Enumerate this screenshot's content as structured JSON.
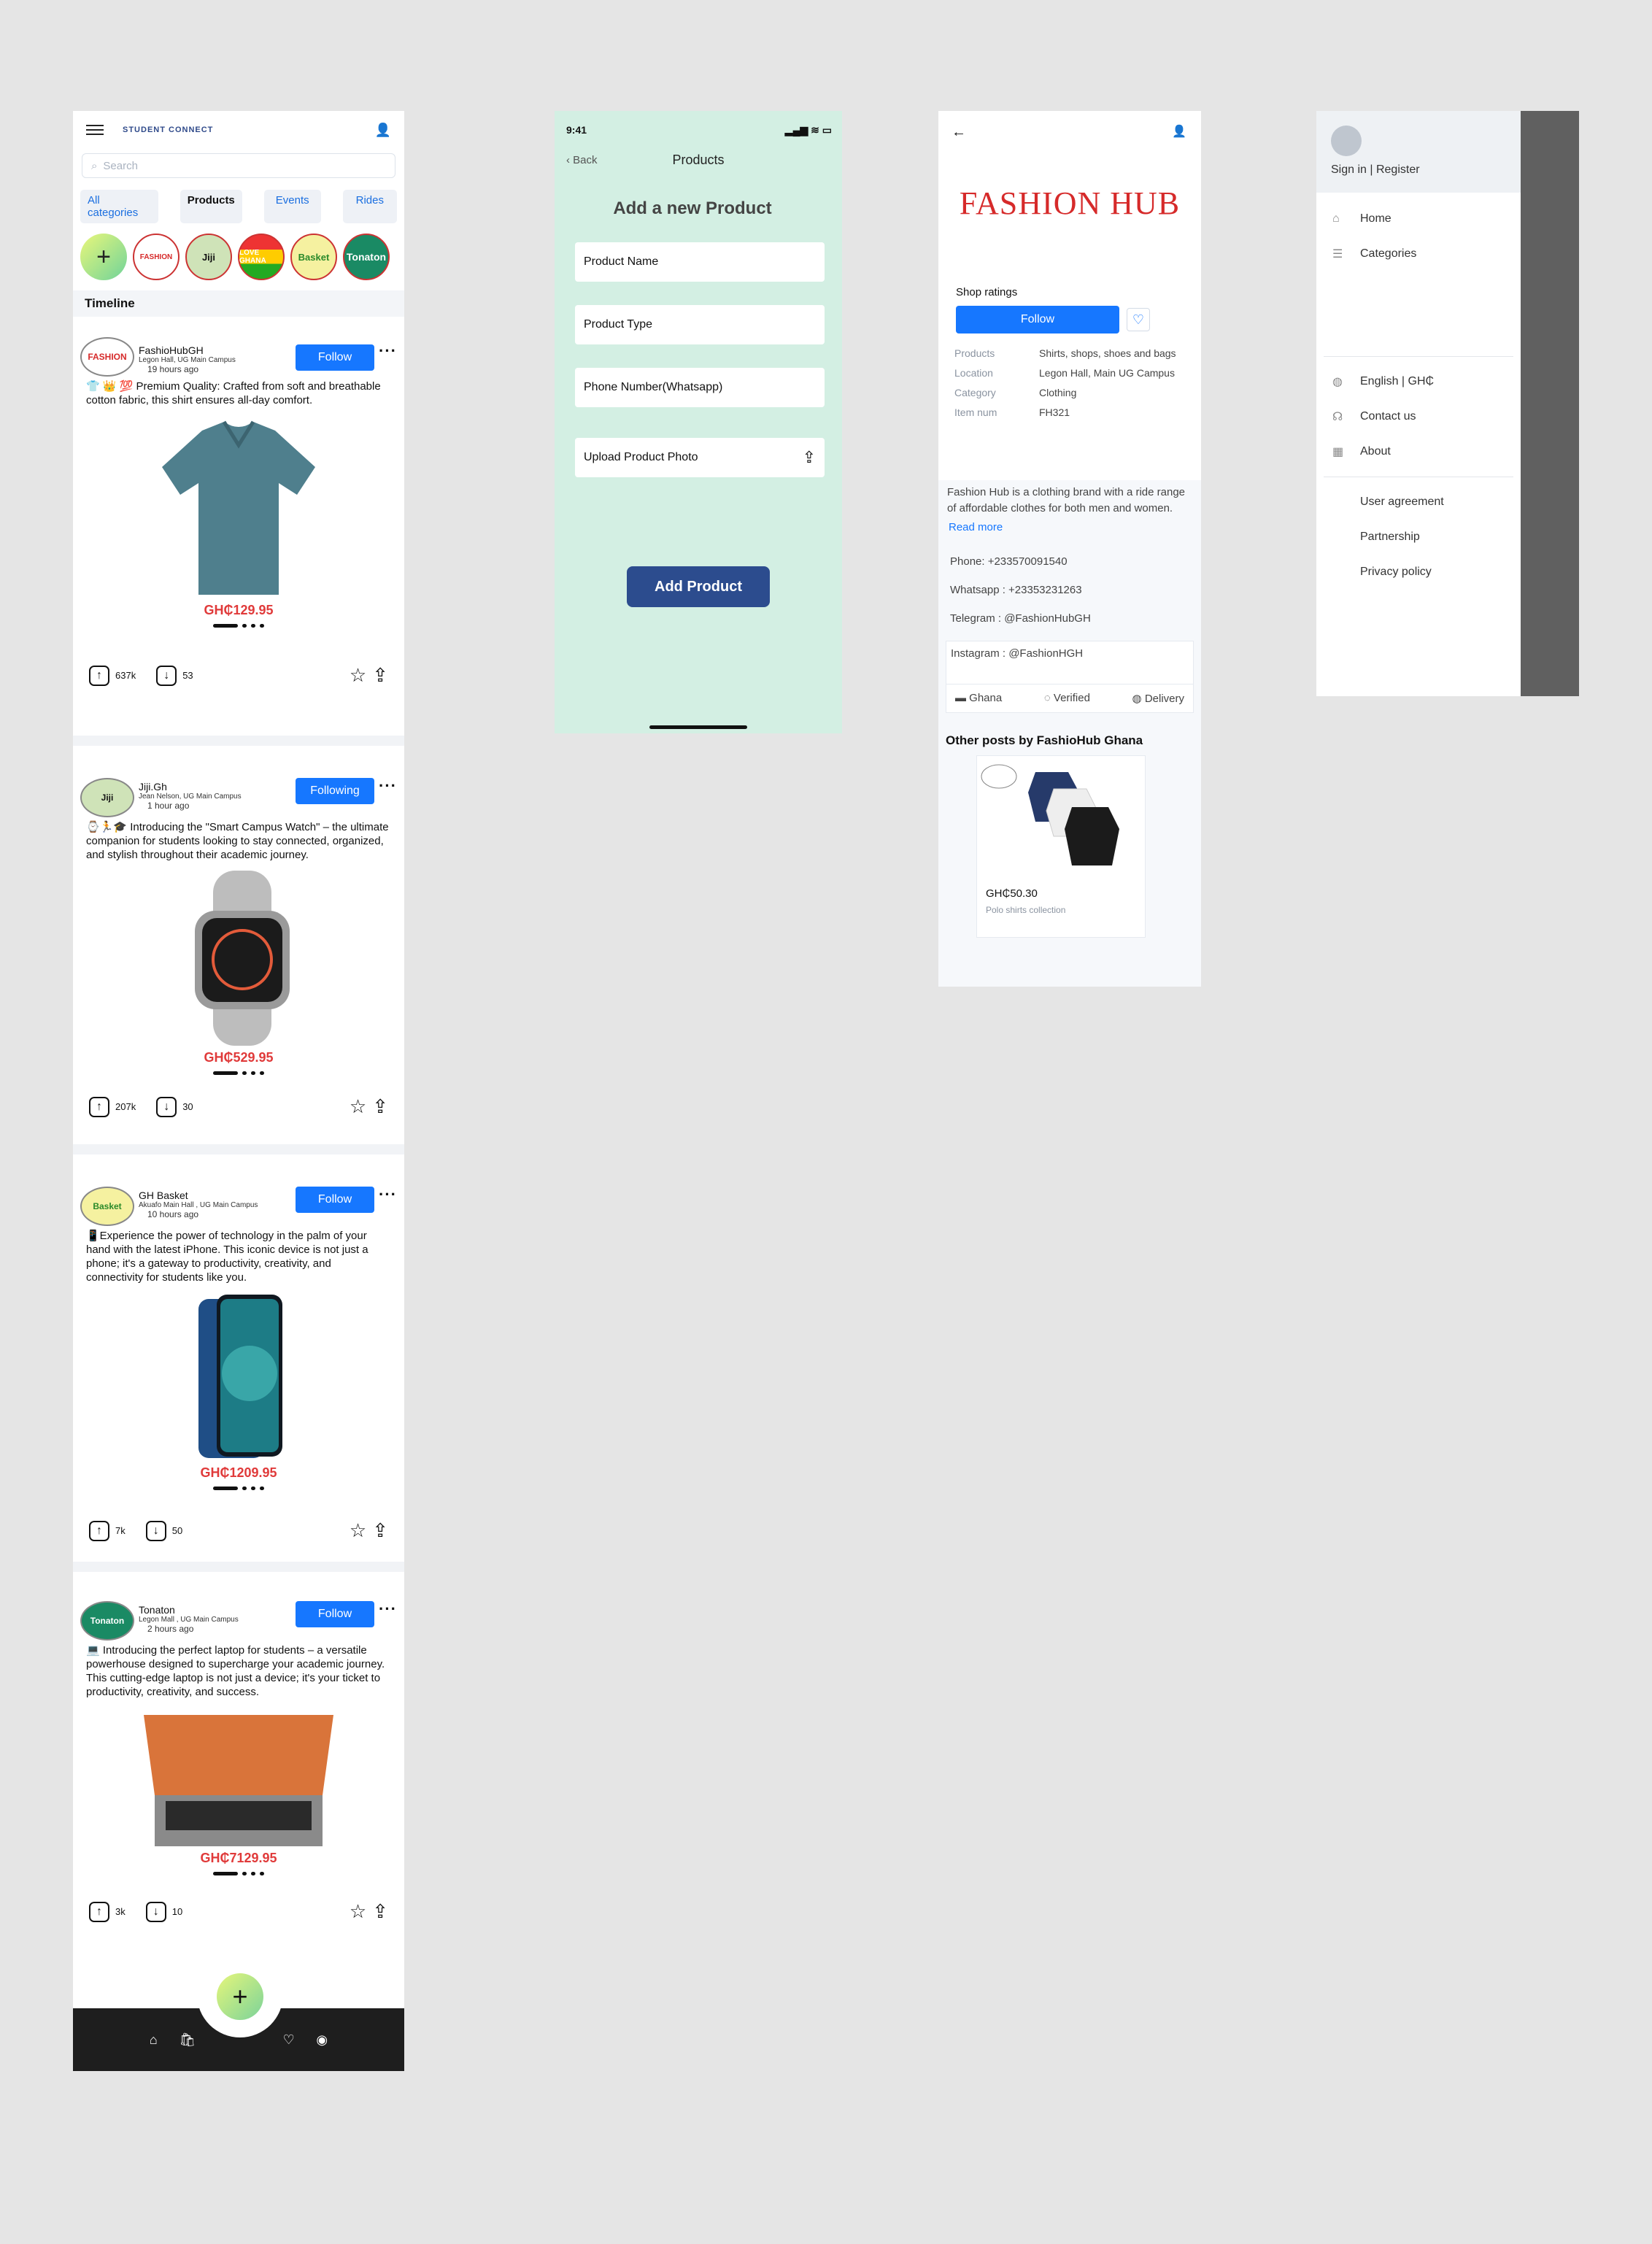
{
  "feed": {
    "logo": "STUDENT CONNECT",
    "search_placeholder": "Search",
    "tabs": [
      "All categories",
      "Products",
      "Events",
      "Rides"
    ],
    "stories": [
      "+",
      "FASHION",
      "Jiji",
      "LOVE GHANA",
      "Basket",
      "Tonaton"
    ],
    "timeline": "Timeline",
    "posts": [
      {
        "name": "FashioHubGH",
        "loc": "Legon Hall, UG Main Campus",
        "time": "19 hours ago",
        "btn": "Follow",
        "text": "👕 👑 💯 Premium Quality: Crafted from soft and breathable cotton fabric, this shirt ensures all-day comfort.",
        "price": "GH₵129.95",
        "up": "637k",
        "down": "53"
      },
      {
        "name": "Jiji.Gh",
        "loc": "Jean Nelson, UG Main Campus",
        "time": "1 hour ago",
        "btn": "Following",
        "text": "⌚🏃🎓 Introducing the \"Smart Campus Watch\" – the ultimate companion for students looking to stay connected, organized, and stylish throughout their academic journey.",
        "price": "GH₵529.95",
        "up": "207k",
        "down": "30"
      },
      {
        "name": "GH Basket",
        "loc": "Akuafo Main Hall , UG Main Campus",
        "time": "10 hours ago",
        "btn": "Follow",
        "text": "📱Experience the power of technology in the palm of your hand with the latest iPhone. This iconic device is not just a phone; it's a gateway to productivity, creativity, and connectivity for students like you.",
        "price": "GH₵1209.95",
        "up": "7k",
        "down": "50"
      },
      {
        "name": "Tonaton",
        "loc": "Legon Mall , UG Main Campus",
        "time": "2 hours ago",
        "btn": "Follow",
        "text": "💻 Introducing the perfect laptop for students – a versatile powerhouse designed to supercharge your academic journey. This cutting-edge laptop is not just a device; it's your ticket to productivity, creativity, and success.",
        "price": "GH₵7129.95",
        "up": "3k",
        "down": "10"
      }
    ]
  },
  "add": {
    "time": "9:41",
    "back": "Back",
    "title": "Products",
    "heading": "Add a new Product",
    "fields": [
      "Product Name",
      "Product Type",
      "Phone Number(Whatsapp)",
      "Upload Product Photo"
    ],
    "button": "Add Product"
  },
  "shop": {
    "brand": "FASHION HUB",
    "ratings": "Shop ratings",
    "follow": "Follow",
    "details": [
      [
        "Products",
        "Shirts, shops, shoes and bags"
      ],
      [
        "Location",
        "Legon Hall, Main UG Campus"
      ],
      [
        "Category",
        "Clothing"
      ],
      [
        "Item num",
        "FH321"
      ]
    ],
    "desc": "Fashion Hub is a clothing brand with a ride range of affordable clothes for both men and women.",
    "readmore": "Read more",
    "phone": "Phone: +233570091540",
    "whatsapp": "Whatsapp : +23353231263",
    "telegram": "Telegram  :  @FashionHubGH",
    "instagram": "Instagram  : @FashionHGH",
    "badges": [
      "Ghana",
      "Verified",
      "Delivery"
    ],
    "other": "Other posts by FashioHub Ghana",
    "card_price": "GH₵50.30",
    "card_desc": "Polo shirts collection"
  },
  "drawer": {
    "signin": "Sign in | Register",
    "items": [
      "Home",
      "Categories"
    ],
    "items2": [
      "English | GH₵",
      "Contact us",
      "About"
    ],
    "items3": [
      "User agreement",
      "Partnership",
      "Privacy policy"
    ]
  }
}
